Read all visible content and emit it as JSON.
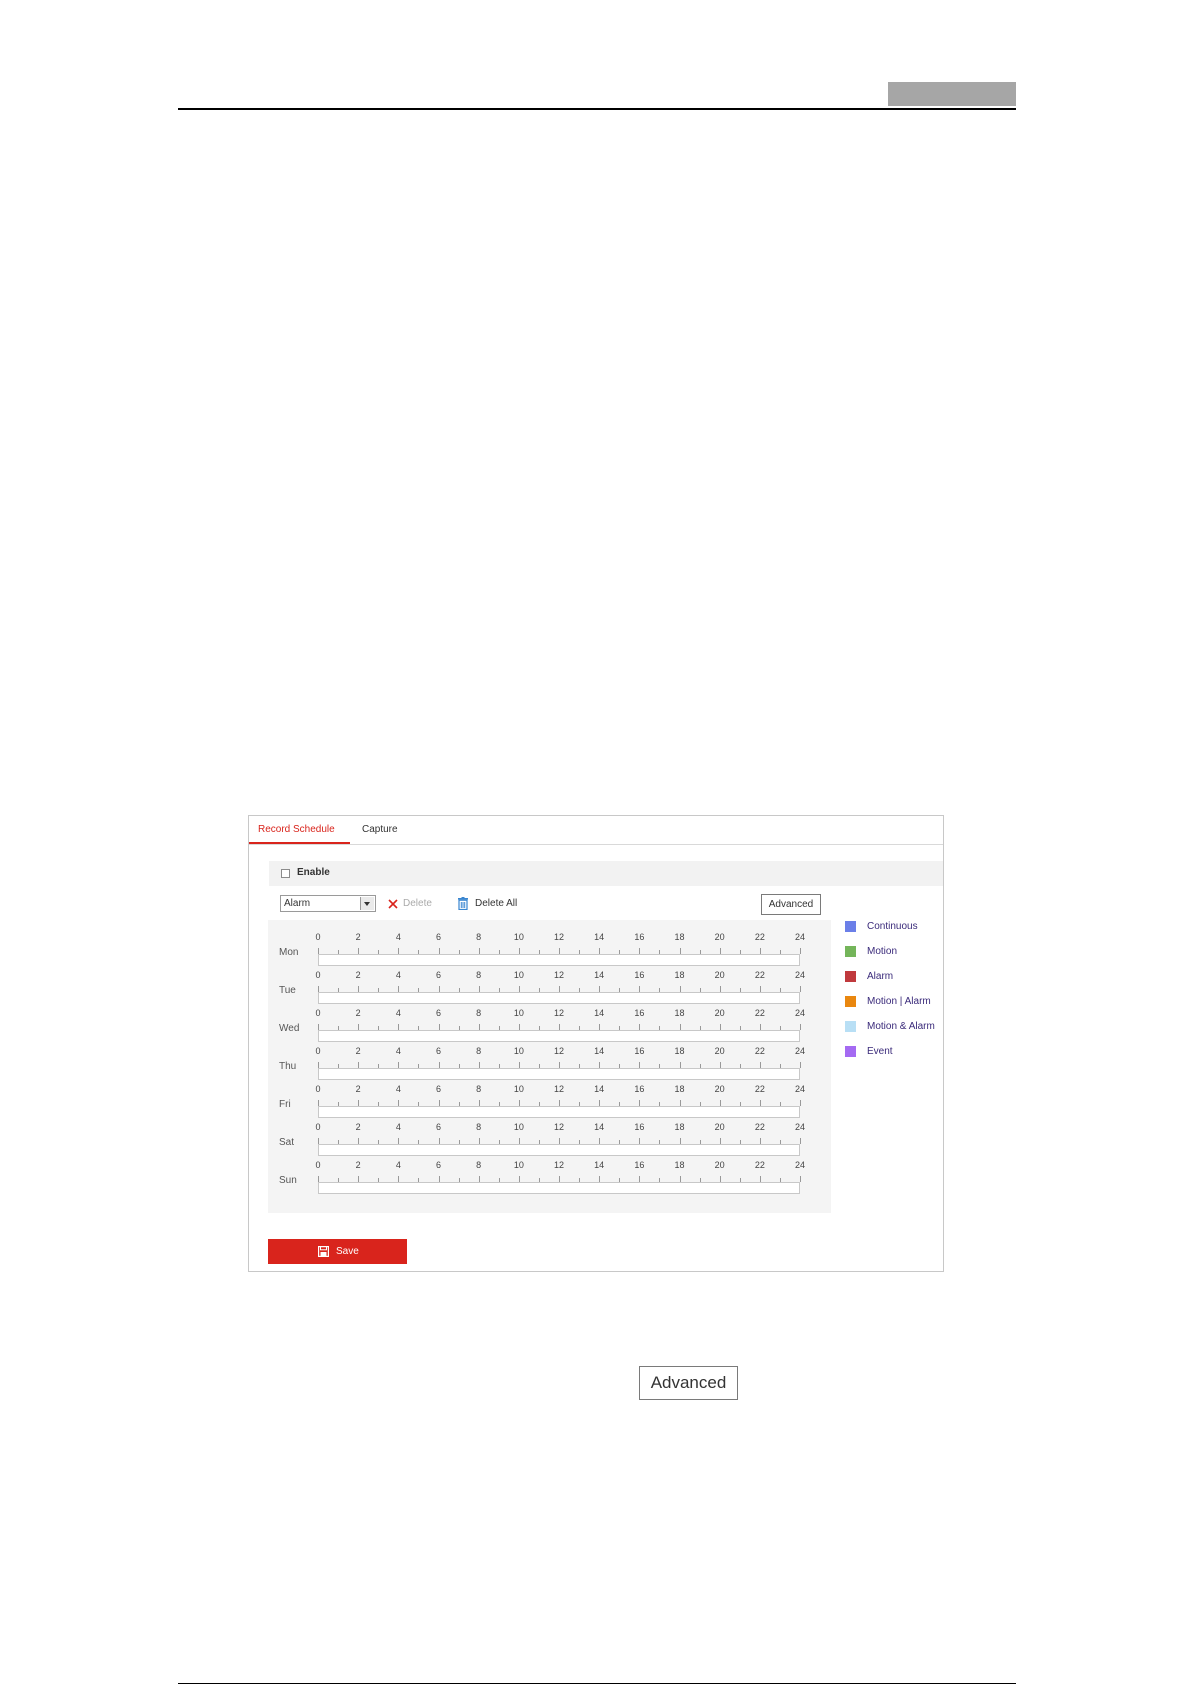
{
  "panel": {
    "tabs": [
      {
        "label": "Record Schedule",
        "active": true
      },
      {
        "label": "Capture",
        "active": false
      }
    ],
    "enable": {
      "label": "Enable",
      "checked": false
    },
    "toolbar": {
      "type_select": {
        "value": "Alarm"
      },
      "delete_label": "Delete",
      "delete_all_label": "Delete All",
      "advanced_label": "Advanced"
    },
    "schedule": {
      "days": [
        "Mon",
        "Tue",
        "Wed",
        "Thu",
        "Fri",
        "Sat",
        "Sun"
      ],
      "hour_ticks": [
        "0",
        "2",
        "4",
        "6",
        "8",
        "10",
        "12",
        "14",
        "16",
        "18",
        "20",
        "22",
        "24"
      ]
    },
    "legend": [
      {
        "label": "Continuous",
        "color": "#6b7fe8"
      },
      {
        "label": "Motion",
        "color": "#74b55a"
      },
      {
        "label": "Alarm",
        "color": "#c0393d"
      },
      {
        "label": "Motion | Alarm",
        "color": "#e9870f"
      },
      {
        "label": "Motion & Alarm",
        "color": "#b8dff5"
      },
      {
        "label": "Event",
        "color": "#a46af2"
      }
    ],
    "save_label": "Save"
  },
  "inline_button": {
    "label": "Advanced"
  },
  "colors": {
    "accent": "#d9241c",
    "delete_all_icon": "#3a86d0",
    "delete_icon": "#d9241c"
  }
}
